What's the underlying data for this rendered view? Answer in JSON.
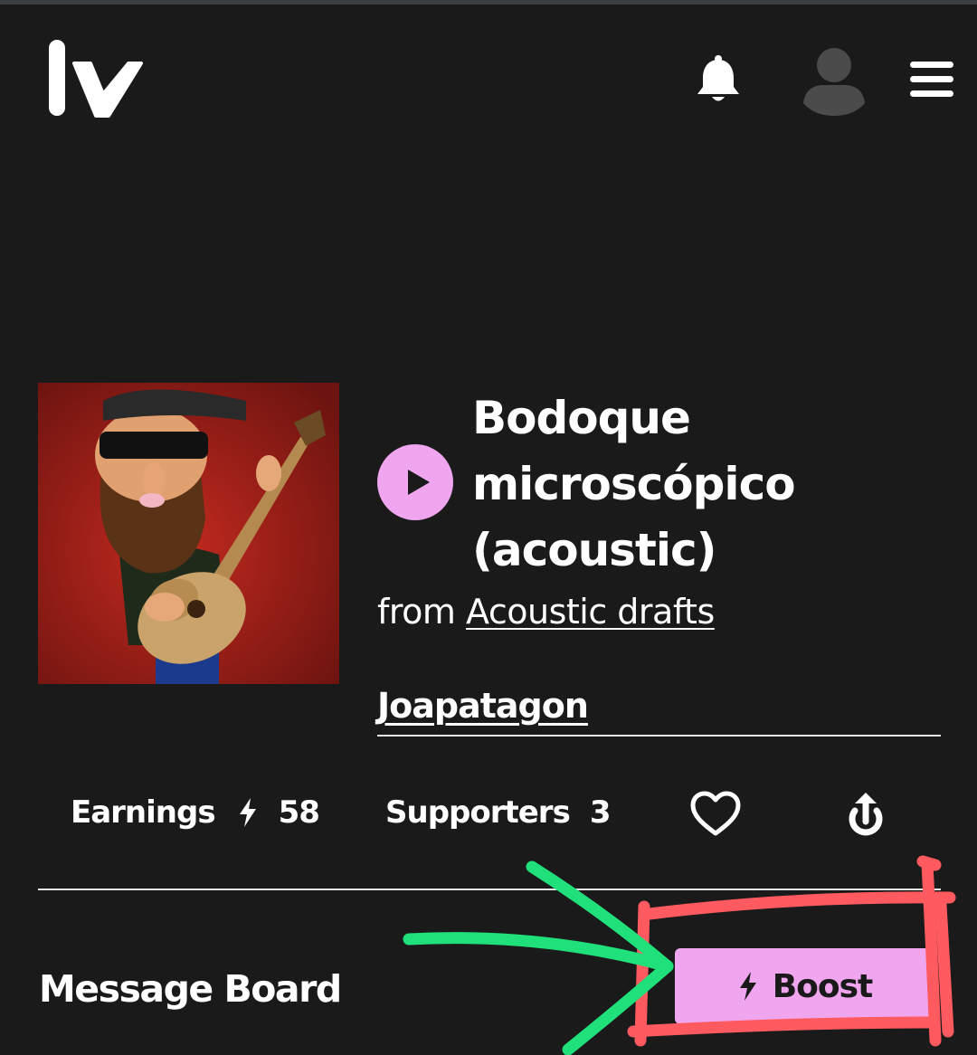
{
  "header": {
    "logo_icon": "lv-logo-icon",
    "notification_icon": "bell-icon",
    "profile_icon": "user-avatar-icon",
    "menu_icon": "hamburger-menu-icon"
  },
  "track": {
    "cover_image": "cartoon bearded guitarist with sunglasses",
    "play_icon": "play-icon",
    "title": "Bodoque microscópico (acoustic)",
    "from_label": "from",
    "album": "Acoustic drafts",
    "artist": "Joapatagon"
  },
  "stats": {
    "earnings_label": "Earnings",
    "earnings_icon": "lightning-bolt-icon",
    "earnings_value": "58",
    "supporters_label": "Supporters",
    "supporters_value": "3",
    "like_icon": "heart-icon",
    "share_icon": "share-icon"
  },
  "message_board": {
    "title": "Message Board",
    "boost_label": "Boost",
    "boost_icon": "lightning-bolt-icon"
  },
  "colors": {
    "background": "#1a1a1a",
    "accent_pink": "#efa6ee",
    "text": "#ffffff",
    "annotation_red": "#ff5a5f",
    "annotation_green": "#1fe07a"
  }
}
